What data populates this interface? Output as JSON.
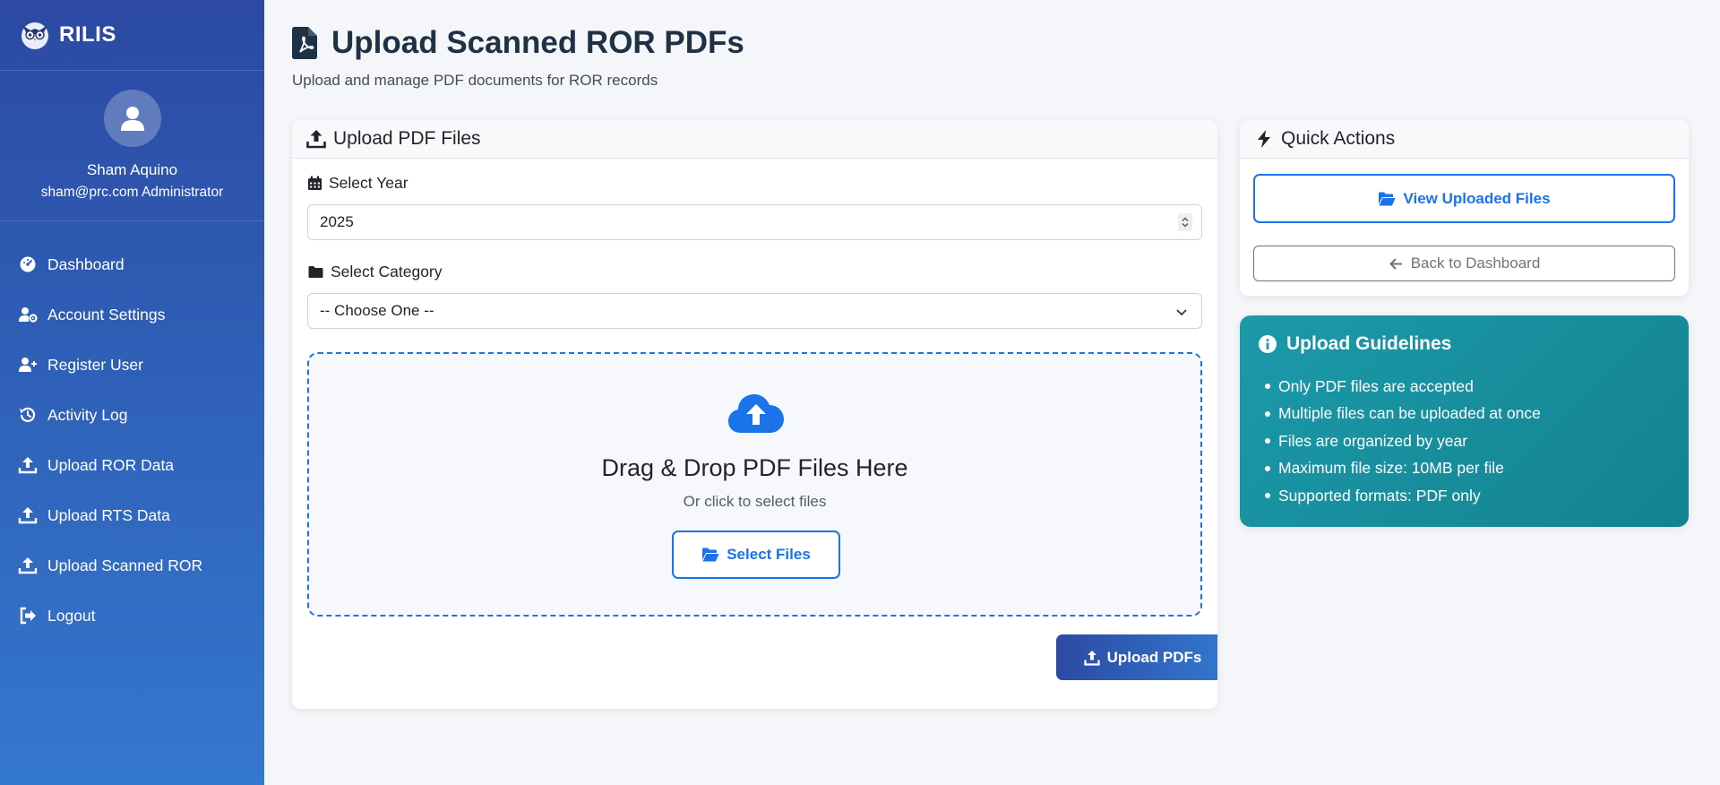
{
  "brand": {
    "name": "RILIS"
  },
  "user": {
    "name": "Sham Aquino",
    "email_role": "sham@prc.com Administrator"
  },
  "nav": [
    {
      "label": "Dashboard",
      "icon": "gauge-icon"
    },
    {
      "label": "Account Settings",
      "icon": "user-gear-icon"
    },
    {
      "label": "Register User",
      "icon": "user-plus-icon"
    },
    {
      "label": "Activity Log",
      "icon": "history-icon"
    },
    {
      "label": "Upload ROR Data",
      "icon": "upload-icon"
    },
    {
      "label": "Upload RTS Data",
      "icon": "upload-icon"
    },
    {
      "label": "Upload Scanned ROR",
      "icon": "upload-icon"
    },
    {
      "label": "Logout",
      "icon": "logout-icon"
    }
  ],
  "page": {
    "title": "Upload Scanned ROR PDFs",
    "subtitle": "Upload and manage PDF documents for ROR records"
  },
  "upload_card": {
    "header": "Upload PDF Files",
    "year_label": "Select Year",
    "year_value": "2025",
    "category_label": "Select Category",
    "category_value": "-- Choose One --",
    "dropzone_title": "Drag & Drop PDF Files Here",
    "dropzone_sub": "Or click to select files",
    "select_files": "Select Files",
    "upload_button": "Upload PDFs"
  },
  "quick_actions": {
    "header": "Quick Actions",
    "view_files": "View Uploaded Files",
    "back": "Back to Dashboard"
  },
  "guidelines": {
    "title": "Upload Guidelines",
    "items": [
      "Only PDF files are accepted",
      "Multiple files can be uploaded at once",
      "Files are organized by year",
      "Maximum file size: 10MB per file",
      "Supported formats: PDF only"
    ]
  },
  "colors": {
    "primary": "#1a73e8",
    "sidebar_top": "#2c49a3",
    "sidebar_bottom": "#3478cf",
    "guide_teal": "#1b9aaa"
  }
}
